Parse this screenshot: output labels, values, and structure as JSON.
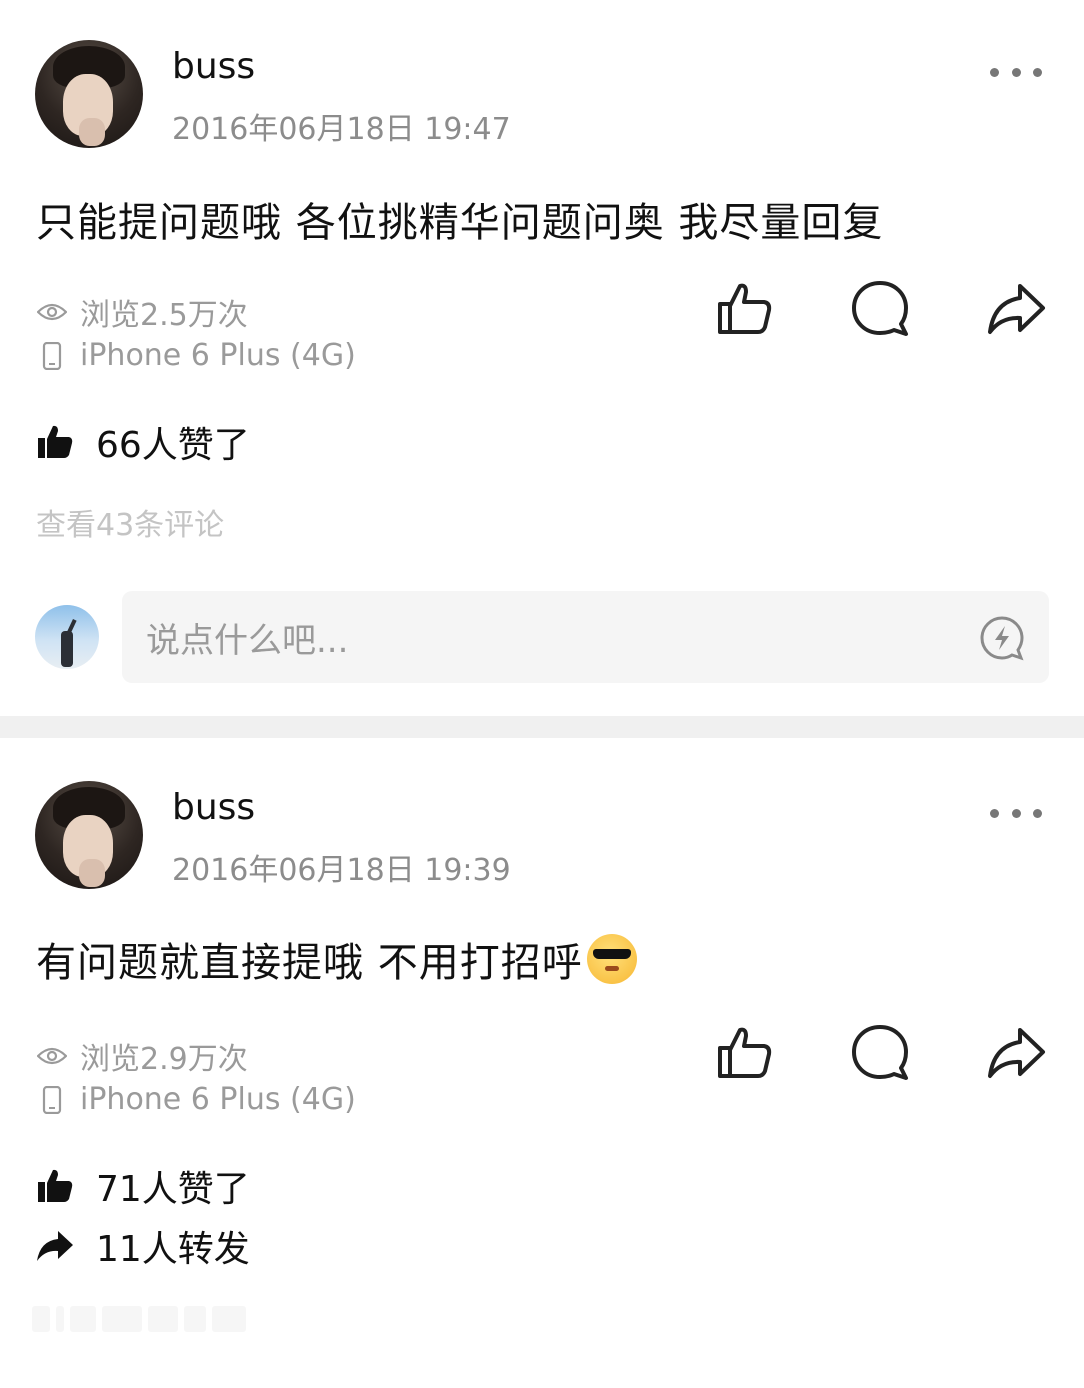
{
  "posts": [
    {
      "username": "buss",
      "timestamp": "2016年06月18日 19:47",
      "content": "只能提问题哦 各位挑精华问题问奥 我尽量回复",
      "views": "浏览2.5万次",
      "device": "iPhone 6 Plus (4G)",
      "likes": "66人赞了",
      "view_comments": "查看43条评论",
      "comment_placeholder": "说点什么吧..."
    },
    {
      "username": "buss",
      "timestamp": "2016年06月18日 19:39",
      "content": "有问题就直接提哦 不用打招呼",
      "emoji": "cool-sunglasses-emoji",
      "views": "浏览2.9万次",
      "device": "iPhone 6 Plus (4G)",
      "likes": "71人赞了",
      "reposts": "11人转发"
    }
  ],
  "icons": {
    "more": "more-dots-icon",
    "eye": "eye-icon",
    "phone": "phone-icon",
    "like": "thumb-up-icon",
    "comment": "comment-bubble-icon",
    "share": "share-arrow-icon",
    "liked": "thumb-up-filled-icon",
    "repost": "repost-arrow-filled-icon",
    "emoji_picker": "lightning-bubble-icon"
  },
  "colors": {
    "text": "#111111",
    "secondary": "#8c8c8c",
    "muted": "#c4c4c4",
    "input_bg": "#f5f5f5",
    "divider": "#f0f0f0"
  }
}
